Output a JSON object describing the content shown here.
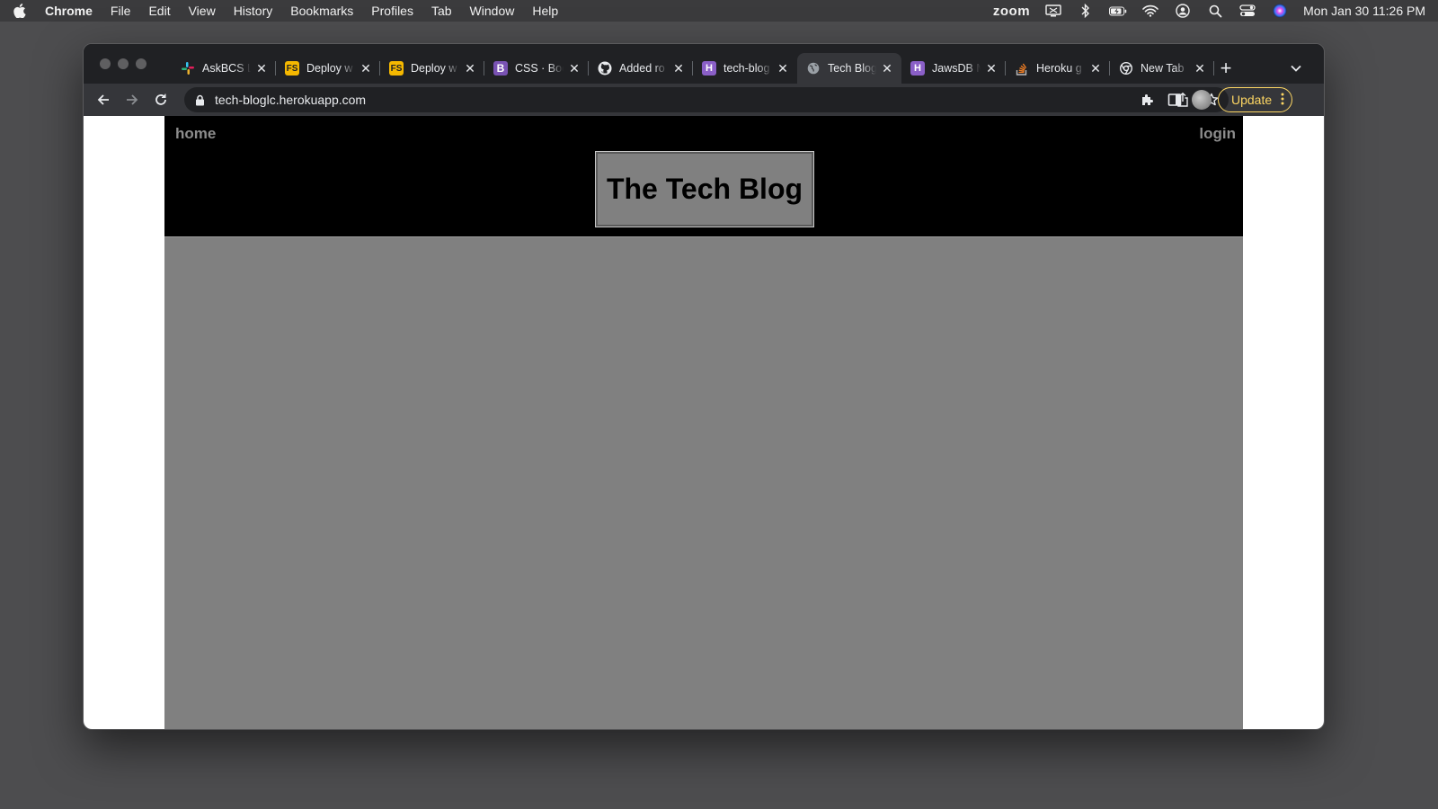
{
  "menubar": {
    "app": "Chrome",
    "items": [
      "File",
      "Edit",
      "View",
      "History",
      "Bookmarks",
      "Profiles",
      "Tab",
      "Window",
      "Help"
    ],
    "zoom": "zoom",
    "clock": "Mon Jan 30  11:26 PM"
  },
  "tabs": [
    {
      "title": "AskBCS L",
      "favicon": "slack-icon",
      "color": "#e01e5a"
    },
    {
      "title": "Deploy w",
      "favicon": "fs-icon",
      "color": "#f5b800"
    },
    {
      "title": "Deploy w",
      "favicon": "fs-icon",
      "color": "#f5b800"
    },
    {
      "title": "CSS · Boo",
      "favicon": "bootstrap-icon",
      "color": "#7952b3"
    },
    {
      "title": "Added ro",
      "favicon": "github-icon",
      "color": "#ffffff"
    },
    {
      "title": "tech-blog",
      "favicon": "heroku-icon",
      "color": "#8a5fc7"
    },
    {
      "title": "Tech Blog",
      "favicon": "globe-icon",
      "color": "#9aa0a6",
      "active": true
    },
    {
      "title": "JawsDB M",
      "favicon": "heroku-icon",
      "color": "#8a5fc7"
    },
    {
      "title": "Heroku g",
      "favicon": "stackoverflow-icon",
      "color": "#f48024"
    },
    {
      "title": "New Tab",
      "favicon": "chrome-icon",
      "color": "#e8eaed"
    }
  ],
  "toolbar": {
    "url": "tech-bloglc.herokuapp.com",
    "update_label": "Update"
  },
  "site": {
    "nav_home": "home",
    "nav_login": "login",
    "title": "The Tech Blog"
  }
}
